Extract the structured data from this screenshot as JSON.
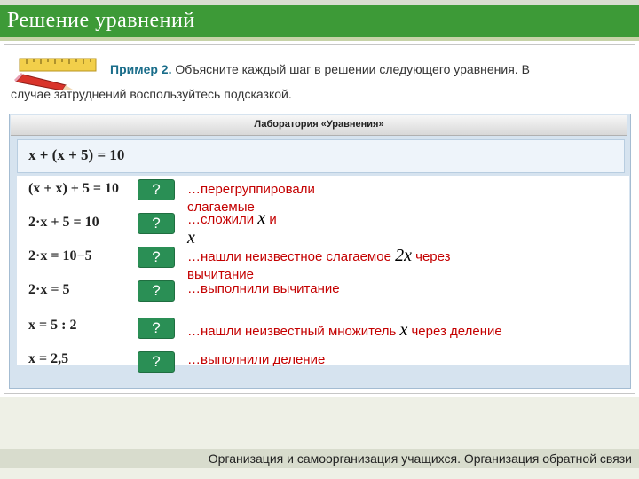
{
  "header": {
    "title": "Решение уравнений"
  },
  "task": {
    "label": "Пример 2.",
    "text_line1": "Объясните каждый шаг в решении следующего уравнения. В",
    "text_line2": "случае затруднений воспользуйтесь подсказкой."
  },
  "lab": {
    "title": "Лаборатория «Уравнения»",
    "equation": "x + (x + 5) = 10",
    "steps": [
      {
        "equation": "(x + x) + 5 = 10",
        "button": "?",
        "explanation": "…перегруппировали слагаемые"
      },
      {
        "equation": "2·x + 5 = 10",
        "button": "?",
        "explanation_before": "…сложили ",
        "var1": "x",
        "mid": " и ",
        "var2": "x"
      },
      {
        "equation": "2·x = 10−5",
        "button": "?",
        "explanation_before": "…нашли неизвестное слагаемое ",
        "var": "2x",
        "explanation_after": " через вычитание"
      },
      {
        "equation": "2·x = 5",
        "button": "?",
        "explanation": "…выполнили вычитание"
      },
      {
        "equation": "x = 5 : 2",
        "button": "?",
        "explanation_before": "…нашли неизвестный множитель ",
        "var": "x",
        "explanation_after": " через деление"
      },
      {
        "equation": "x = 2,5",
        "button": "?",
        "explanation": "…выполнили деление"
      }
    ]
  },
  "footer": {
    "text": "Организация и самоорганизация учащихся. Организация обратной связи"
  },
  "colors": {
    "header": "#3d9a37",
    "button": "#2a8f55",
    "explanation": "#c40000",
    "task_label": "#1a6d8a"
  }
}
